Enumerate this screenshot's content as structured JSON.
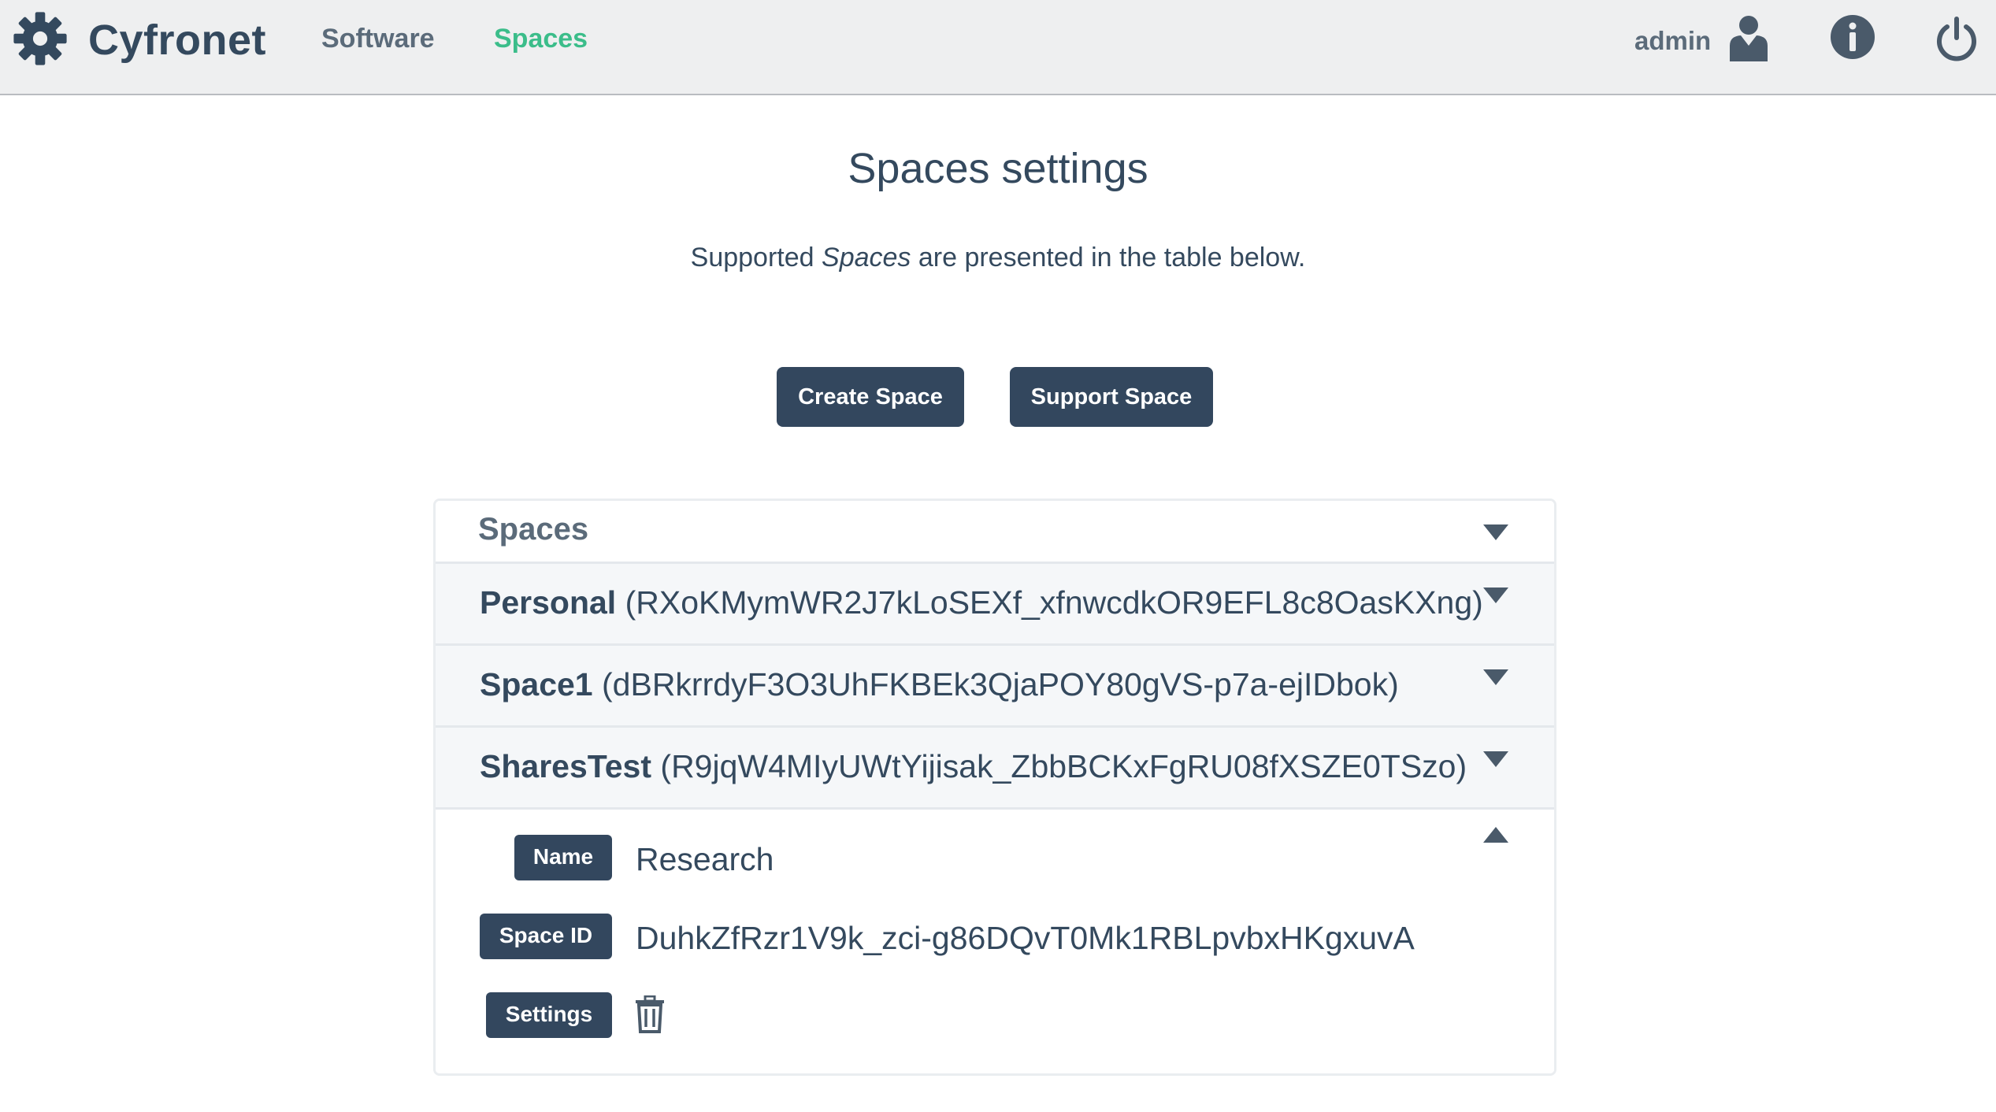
{
  "nav": {
    "brand": "Cyfronet",
    "links": {
      "software": "Software",
      "spaces": "Spaces"
    },
    "active_link": "Spaces",
    "user": "admin",
    "icons": [
      "gear-icon",
      "user-icon",
      "info-icon",
      "power-icon"
    ]
  },
  "page": {
    "title": "Spaces settings",
    "desc_before": "Supported ",
    "desc_em": "Spaces",
    "desc_after": " are presented in the table below."
  },
  "buttons": {
    "create": "Create Space",
    "support": "Support Space"
  },
  "table": {
    "title": "Spaces",
    "rows": [
      {
        "name": "Personal",
        "id": "(RXoKMymWR2J7kLoSEXf_xfnwcdkOR9EFL8c8OasKXng)",
        "expanded": false
      },
      {
        "name": "Space1",
        "id": "(dBRkrrdyF3O3UhFKBEk3QjaPOY80gVS-p7a-ejIDbok)",
        "expanded": false
      },
      {
        "name": "SharesTest",
        "id": "(R9jqW4MIyUWtYijisak_ZbbBCKxFgRU08fXSZE0TSzo)",
        "expanded": true
      }
    ],
    "detail": {
      "name_label": "Name",
      "name_value": "Research",
      "id_label": "Space ID",
      "id_value": "DuhkZfRzr1V9k_zci-g86DQvT0Mk1RBLpvbxHKgxuvA",
      "settings_label": "Settings"
    }
  },
  "colors": {
    "navbar_bg": "#eeeff0",
    "primary": "#33475e",
    "accent": "#3bbd8a",
    "text": "#34495e",
    "row_bg": "#f5f7f9"
  }
}
